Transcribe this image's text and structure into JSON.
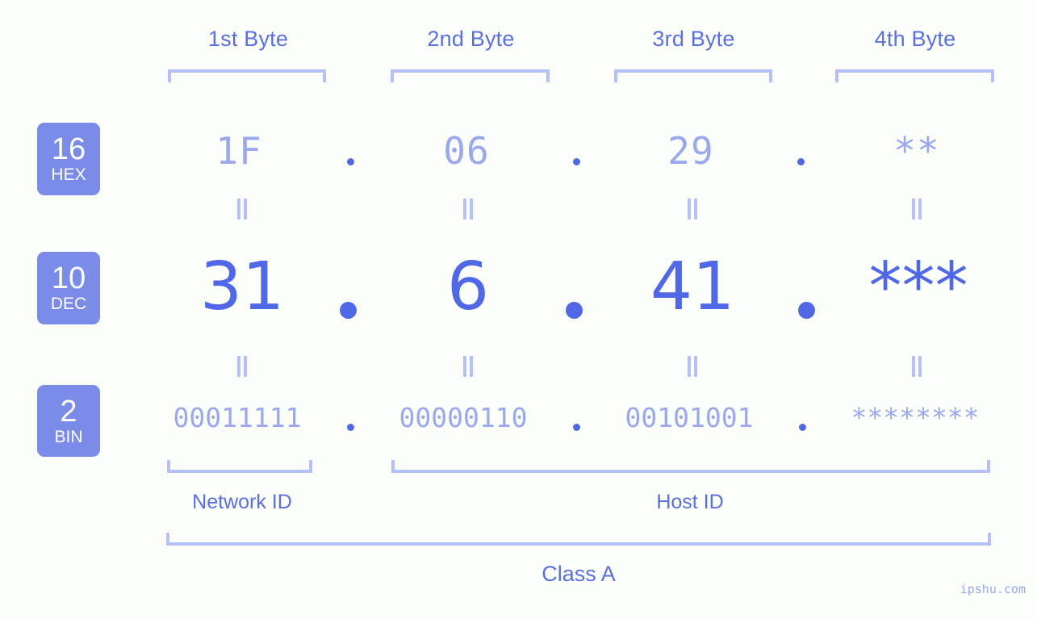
{
  "header": {
    "byte_labels": [
      "1st Byte",
      "2nd Byte",
      "3rd Byte",
      "4th Byte"
    ]
  },
  "bases": [
    {
      "number": "16",
      "abbr": "HEX"
    },
    {
      "number": "10",
      "abbr": "DEC"
    },
    {
      "number": "2",
      "abbr": "BIN"
    }
  ],
  "rows": {
    "hex": {
      "values": [
        "1F",
        "06",
        "29",
        "**"
      ]
    },
    "dec": {
      "values": [
        "31",
        "6",
        "41",
        "***"
      ]
    },
    "bin": {
      "values": [
        "00011111",
        "00000110",
        "00101001",
        "********"
      ]
    }
  },
  "separators": {
    "glyph": "."
  },
  "connectors": {
    "glyph": "="
  },
  "footer": {
    "network_id_label": "Network ID",
    "host_id_label": "Host ID",
    "class_label": "Class A",
    "watermark": "ipshu.com"
  },
  "colors": {
    "background": "#fbfdf8",
    "badge_bg": "#7b8ce8",
    "badge_text": "#ffffff",
    "label_blue": "#5a6fe0",
    "value_light": "#9aa8f0",
    "value_strong": "#5068e8",
    "bracket": "#b4c0f7"
  }
}
